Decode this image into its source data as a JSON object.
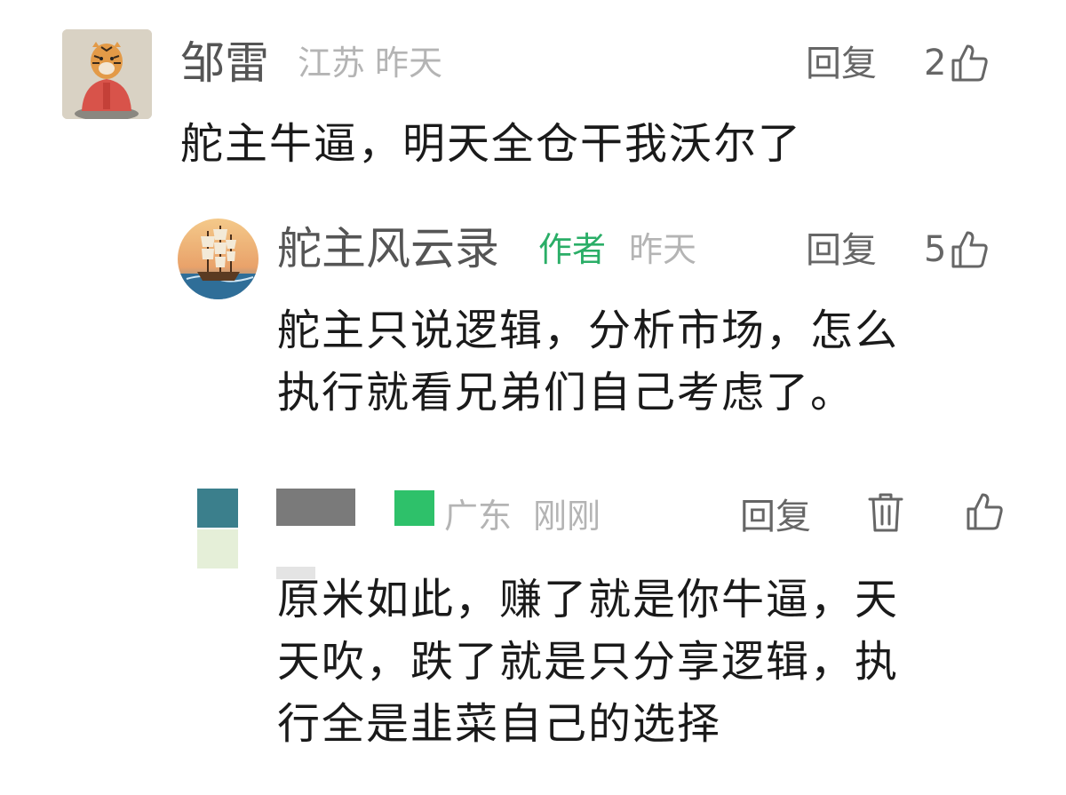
{
  "comments": [
    {
      "user": "邹雷",
      "location": "江苏",
      "time": "昨天",
      "reply_label": "回复",
      "likes": "2",
      "text": "舵主牛逼，明天全仓干我沃尔了",
      "avatar_icon": "tiger-portrait-avatar"
    },
    {
      "user": "舵主风云录",
      "author_tag": "作者",
      "time": "昨天",
      "reply_label": "回复",
      "likes": "5",
      "text_lines": [
        "舵主只说逻辑，分析市场，怎么",
        "执行就看兄弟们自己考虑了。"
      ],
      "avatar_icon": "sailing-ship-avatar"
    },
    {
      "location": "广东",
      "time": "刚刚",
      "reply_label": "回复",
      "likes": "",
      "text_lines": [
        "原米如此，赚了就是你牛逼，天",
        "天吹，跌了就是只分享逻辑，执",
        "行全是韭菜自己的选择"
      ],
      "avatar_icon": "pixelated-avatar"
    }
  ],
  "colors": {
    "author_green": "#2aae67",
    "meta_gray": "#b4b4b4",
    "name_gray": "#555555",
    "text_black": "#1a1a1a"
  }
}
